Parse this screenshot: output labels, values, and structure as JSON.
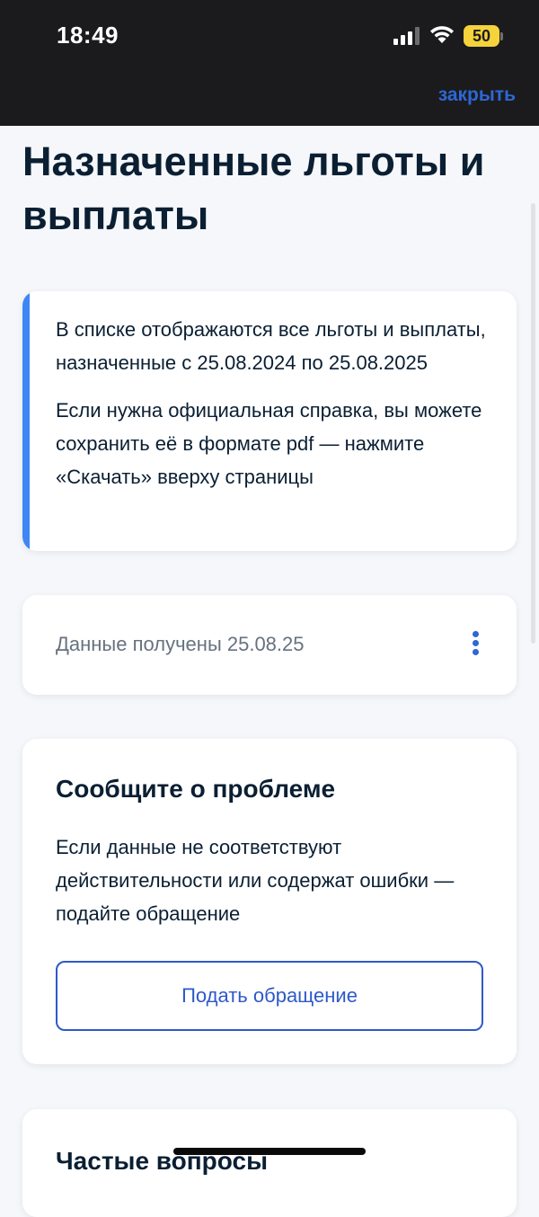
{
  "status_bar": {
    "time": "18:49",
    "battery_level": "50",
    "signal_icon": "cellular-signal-icon",
    "wifi_icon": "wifi-icon"
  },
  "header": {
    "close_label": "закрыть"
  },
  "page": {
    "title": "Назначенные льготы и выплаты"
  },
  "info_card": {
    "paragraph_1": "В списке отображаются все льготы и выплаты, назначенные с 25.08.2024 по 25.08.2025",
    "paragraph_2": "Если нужна официальная справка, вы можете сохранить её в формате pdf — нажмите «Скачать» вверху страницы",
    "accent_color": "#3e86f5"
  },
  "data_card": {
    "text": "Данные получены 25.08.25",
    "more_icon": "more-vertical-icon"
  },
  "problem_card": {
    "title": "Сообщите о проблеме",
    "text": "Если данные не соответствуют действительности или содержат ошибки — подайте обращение",
    "button_label": "Подать обращение"
  },
  "faq_card": {
    "title": "Частые вопросы"
  },
  "colors": {
    "accent": "#2e67d6",
    "text": "#0b1f33",
    "muted": "#66727f",
    "background": "#f5f7fa"
  }
}
